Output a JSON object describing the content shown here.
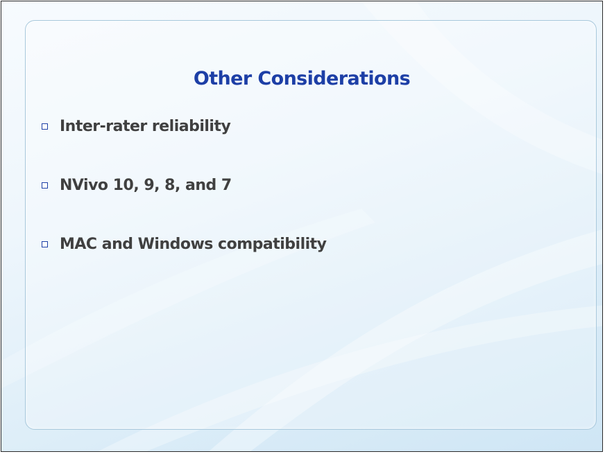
{
  "slide": {
    "title": "Other Considerations",
    "bullets": [
      "Inter-rater reliability",
      "NVivo 10, 9, 8, and 7",
      "MAC and Windows compatibility"
    ]
  },
  "colors": {
    "title": "#1d3fa6",
    "bullet_text": "#404040",
    "bullet_marker": "#1d3fa6",
    "panel_border": "#a8c8dc",
    "background": "#e6f2fa"
  },
  "icons": {
    "bullet_marker": "hollow-square-icon"
  }
}
